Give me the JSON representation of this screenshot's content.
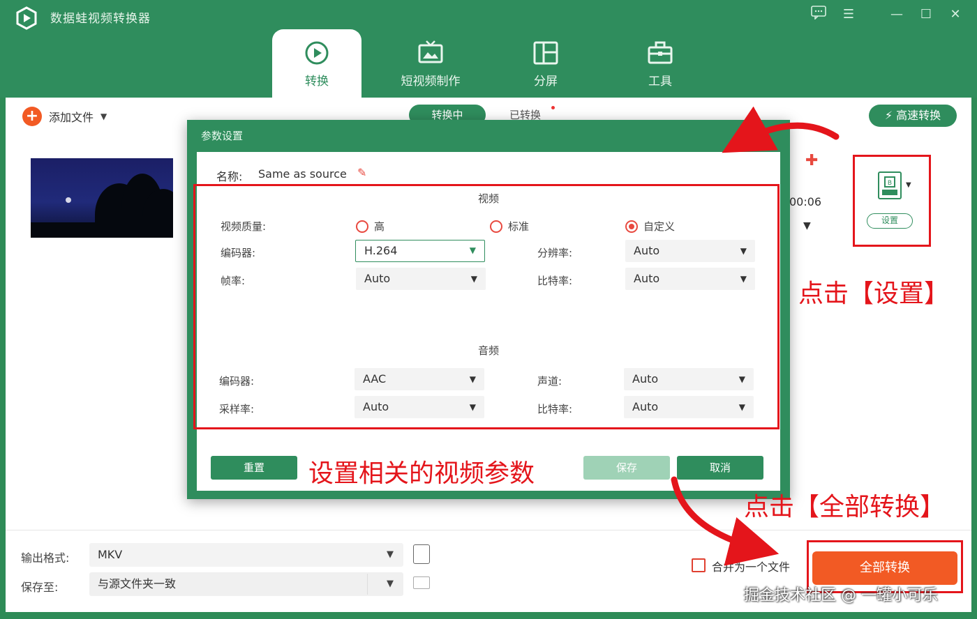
{
  "app": {
    "title": "数据蛙视频转换器"
  },
  "main_tabs": [
    {
      "label": "转换",
      "icon": "convert-icon"
    },
    {
      "label": "短视频制作",
      "icon": "tv-icon"
    },
    {
      "label": "分屏",
      "icon": "split-screen-icon"
    },
    {
      "label": "工具",
      "icon": "toolbox-icon"
    }
  ],
  "toolbar": {
    "add_file": "添加文件",
    "sub_tabs": [
      "转换中",
      "已转换"
    ],
    "turbo": "高速转换"
  },
  "file_item": {
    "duration": "00:06",
    "settings_label": "设置"
  },
  "dialog": {
    "title": "参数设置",
    "name_label": "名称:",
    "name_value": "Same as source",
    "video_section": "视频",
    "audio_section": "音频",
    "video": {
      "quality_label": "视频质量:",
      "quality_options": [
        "高",
        "标准",
        "自定义"
      ],
      "quality_selected": "自定义",
      "encoder_label": "编码器:",
      "encoder": "H.264",
      "resolution_label": "分辨率:",
      "resolution": "Auto",
      "framerate_label": "帧率:",
      "framerate": "Auto",
      "bitrate_label": "比特率:",
      "bitrate": "Auto"
    },
    "audio": {
      "encoder_label": "编码器:",
      "encoder": "AAC",
      "channel_label": "声道:",
      "channel": "Auto",
      "samplerate_label": "采样率:",
      "samplerate": "Auto",
      "bitrate_label": "比特率:",
      "bitrate": "Auto"
    },
    "buttons": {
      "reset": "重置",
      "save": "保存",
      "cancel": "取消"
    }
  },
  "bottom": {
    "output_label": "输出格式:",
    "output_value": "MKV",
    "save_label": "保存至:",
    "save_value": "与源文件夹一致",
    "merge_label": "合并为一个文件",
    "convert_all": "全部转换"
  },
  "annotations": {
    "params": "设置相关的视频参数",
    "settings": "点击【设置】",
    "convert": "点击【全部转换】"
  },
  "watermark": "掘金技术社区 @ 一罐小可乐",
  "colors": {
    "brand_green": "#2f8d5d",
    "accent_orange": "#f25a24",
    "annotation_red": "#e4151b"
  }
}
